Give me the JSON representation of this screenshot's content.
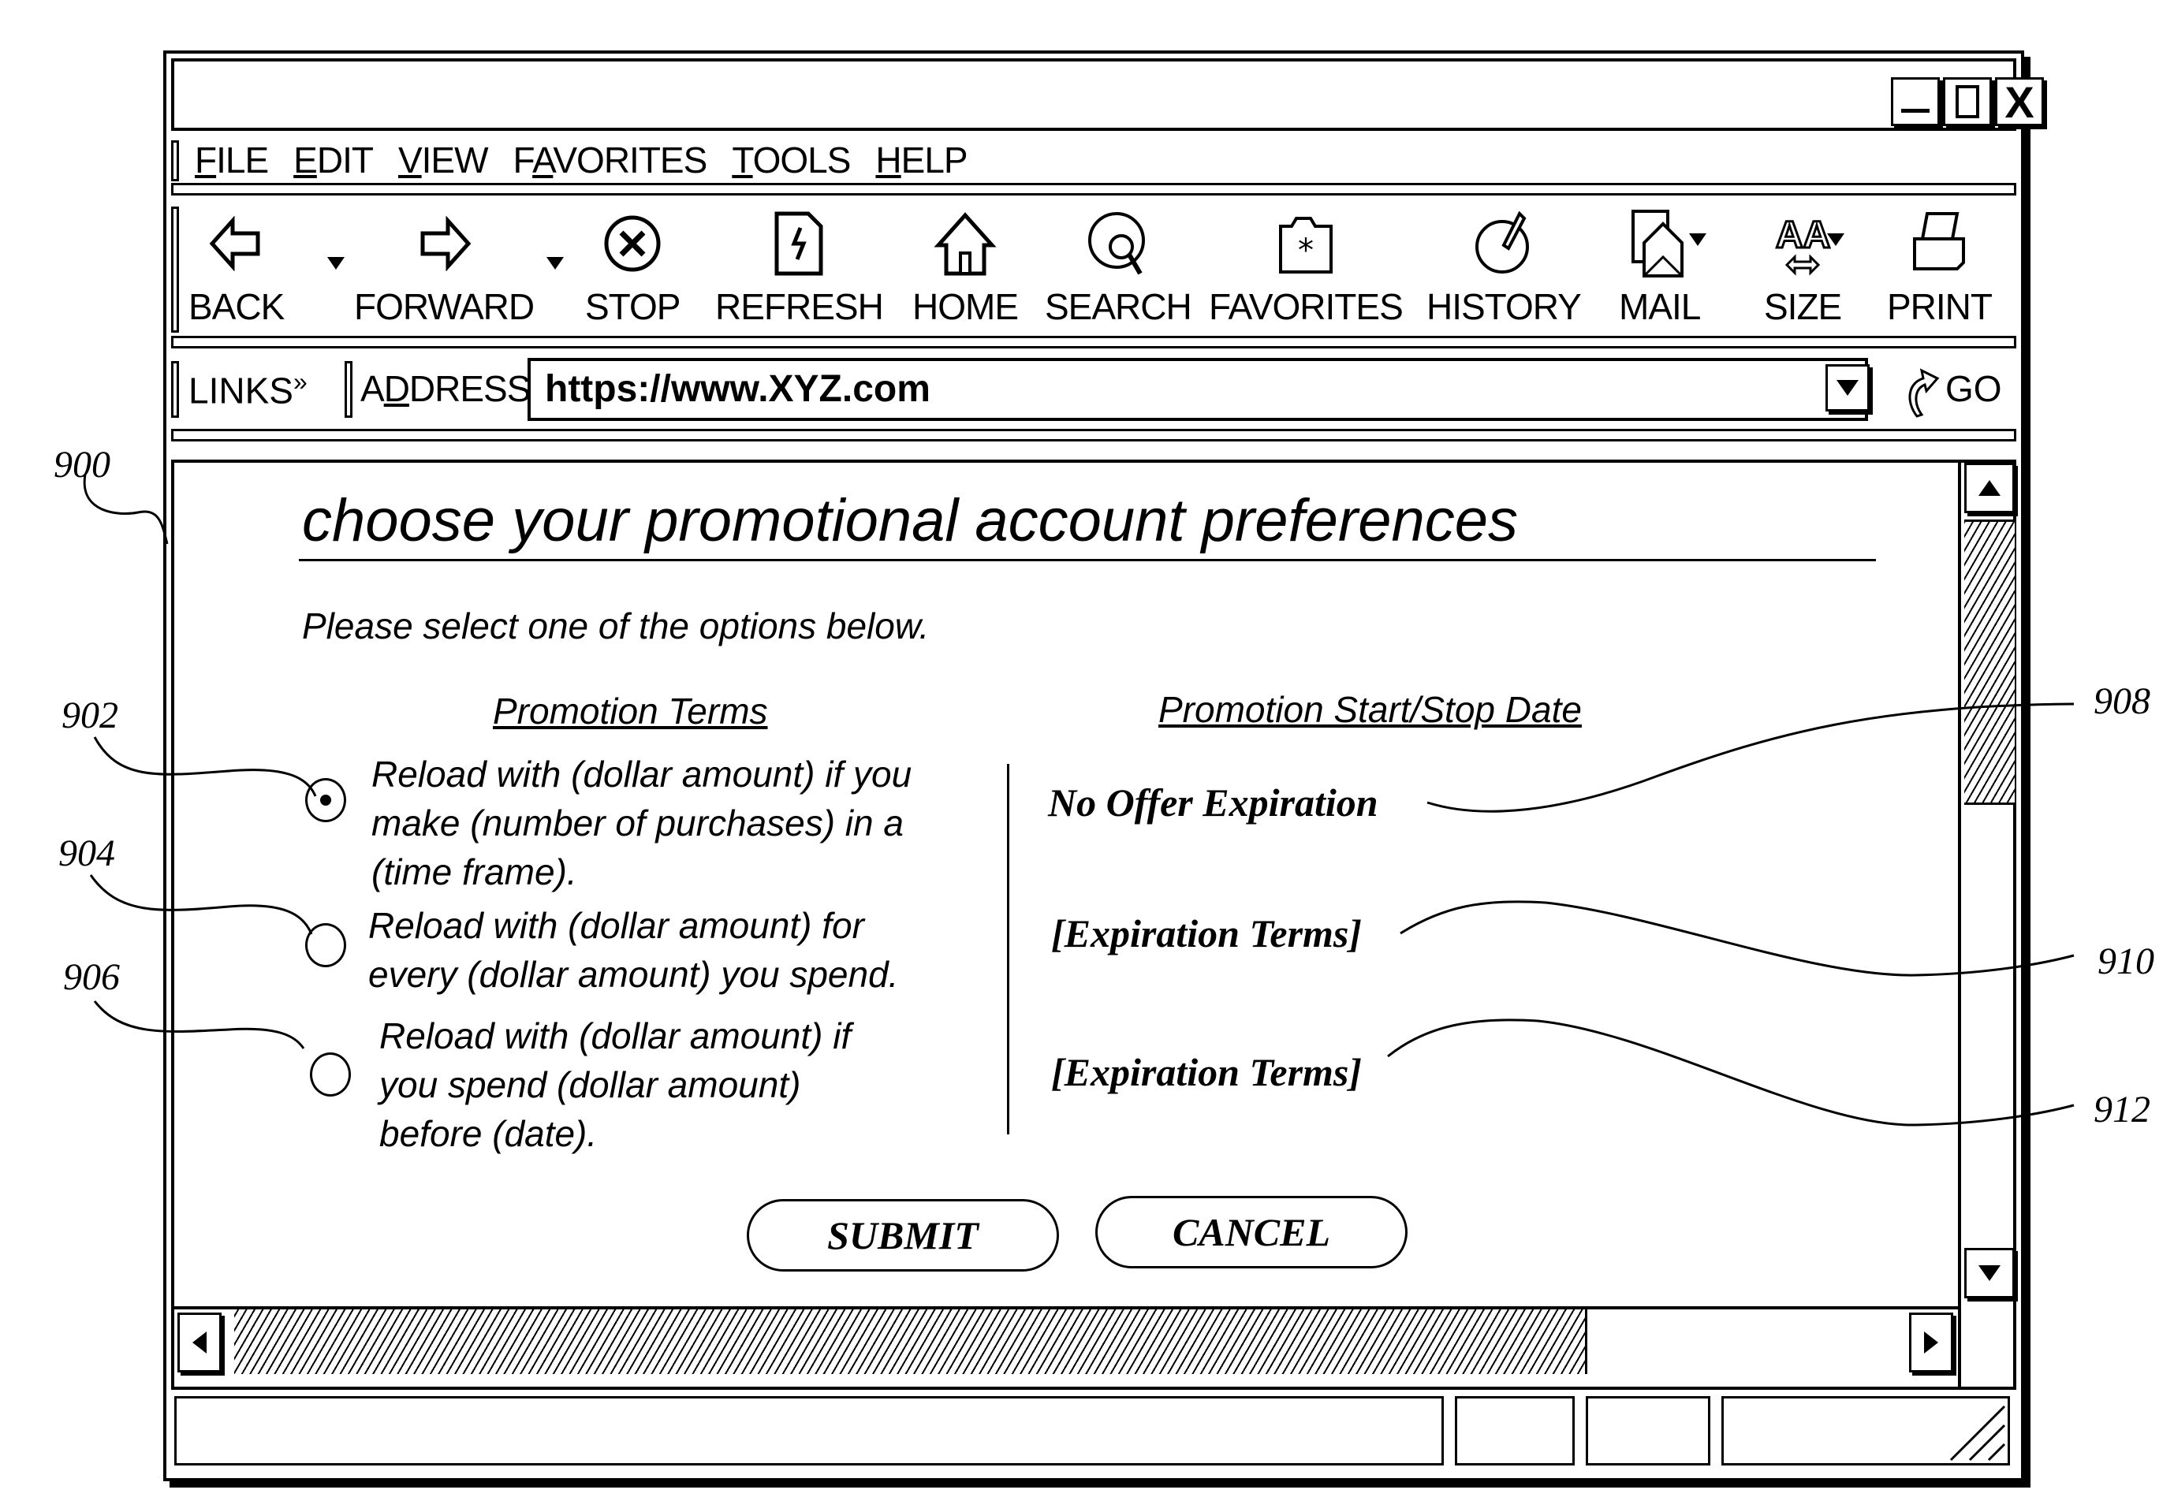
{
  "window": {
    "controls": {
      "minimize": "_",
      "maximize": "□",
      "close": "X"
    }
  },
  "menubar": {
    "items": [
      {
        "label": "FILE",
        "mnemonic": "F",
        "rest": "ILE"
      },
      {
        "label": "EDIT",
        "mnemonic": "E",
        "rest": "DIT"
      },
      {
        "label": "VIEW",
        "mnemonic": "V",
        "rest": "IEW"
      },
      {
        "label": "FAVORITES",
        "pre": "F",
        "mnemonic": "A",
        "rest": "VORITES"
      },
      {
        "label": "TOOLS",
        "mnemonic": "T",
        "rest": "OOLS"
      },
      {
        "label": "HELP",
        "mnemonic": "H",
        "rest": "ELP"
      }
    ]
  },
  "toolbar": {
    "buttons": [
      {
        "label": "BACK",
        "icon": "back-arrow-icon"
      },
      {
        "label": "FORWARD",
        "icon": "forward-arrow-icon"
      },
      {
        "label": "STOP",
        "icon": "stop-icon"
      },
      {
        "label": "REFRESH",
        "icon": "refresh-icon"
      },
      {
        "label": "HOME",
        "icon": "home-icon"
      },
      {
        "label": "SEARCH",
        "icon": "search-icon"
      },
      {
        "label": "FAVORITES",
        "icon": "favorites-icon"
      },
      {
        "label": "HISTORY",
        "icon": "history-icon"
      },
      {
        "label": "MAIL",
        "icon": "mail-icon"
      },
      {
        "label": "SIZE",
        "icon": "font-size-icon"
      },
      {
        "label": "PRINT",
        "icon": "print-icon"
      }
    ]
  },
  "addressbar": {
    "links_label": "LINKS",
    "links_chevron": "»",
    "address_pre": "A",
    "address_mnemonic": "D",
    "address_rest": "DRESS",
    "url": "https://www.XYZ.com",
    "go_label": "GO"
  },
  "page": {
    "heading": "choose your promotional account preferences",
    "instruction": "Please select one of the options below.",
    "col_terms_header": "Promotion Terms",
    "col_dates_header": "Promotion Start/Stop Date",
    "options": [
      {
        "lines": [
          "Reload with (dollar amount) if you",
          "make (number of purchases) in a",
          "(time frame)."
        ],
        "selected": true,
        "expiration": "No Offer Expiration"
      },
      {
        "lines": [
          "Reload with (dollar amount) for",
          "every (dollar amount) you spend."
        ],
        "selected": false,
        "expiration": "[Expiration Terms]"
      },
      {
        "lines": [
          "Reload with (dollar amount) if",
          "you spend (dollar amount)",
          "before (date)."
        ],
        "selected": false,
        "expiration": "[Expiration Terms]"
      }
    ],
    "submit_label": "SUBMIT",
    "cancel_label": "CANCEL"
  },
  "callouts": {
    "window": "900",
    "option1": "902",
    "option2": "904",
    "option3": "906",
    "exp1": "908",
    "exp2": "910",
    "exp3": "912"
  }
}
